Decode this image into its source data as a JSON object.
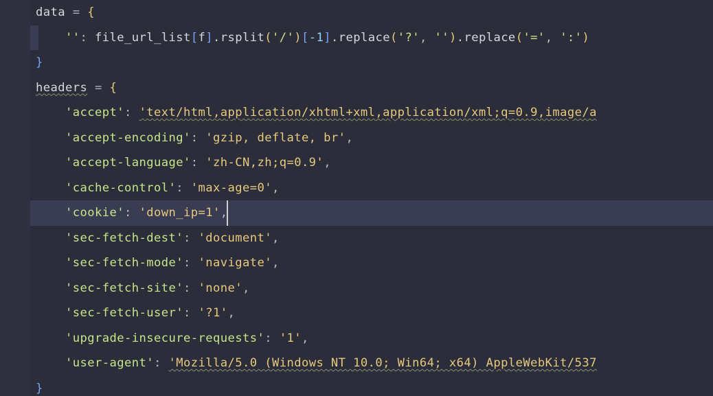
{
  "lines": [
    {
      "indent": 0,
      "segs": [
        {
          "t": "data",
          "c": "c-ident"
        },
        {
          "t": " = ",
          "c": "c-op"
        },
        {
          "t": "{",
          "c": "c-brace"
        }
      ]
    },
    {
      "indent": 1,
      "indentStripe": "big",
      "segs": [
        {
          "t": "''",
          "c": "c-str"
        },
        {
          "t": ": ",
          "c": "c-punct"
        },
        {
          "t": "file_url_list",
          "c": "c-ident"
        },
        {
          "t": "[",
          "c": "c-brace2"
        },
        {
          "t": "f",
          "c": "c-ident"
        },
        {
          "t": "]",
          "c": "c-brace2"
        },
        {
          "t": ".rsplit",
          "c": "c-ident"
        },
        {
          "t": "(",
          "c": "c-brace"
        },
        {
          "t": "'/'",
          "c": "c-str"
        },
        {
          "t": ")",
          "c": "c-brace"
        },
        {
          "t": "[",
          "c": "c-brace2"
        },
        {
          "t": "-1",
          "c": "c-num"
        },
        {
          "t": "]",
          "c": "c-brace2"
        },
        {
          "t": ".replace",
          "c": "c-ident"
        },
        {
          "t": "(",
          "c": "c-brace"
        },
        {
          "t": "'?'",
          "c": "c-str"
        },
        {
          "t": ", ",
          "c": "c-punct"
        },
        {
          "t": "''",
          "c": "c-str"
        },
        {
          "t": ")",
          "c": "c-brace"
        },
        {
          "t": ".replace",
          "c": "c-ident"
        },
        {
          "t": "(",
          "c": "c-brace"
        },
        {
          "t": "'='",
          "c": "c-str"
        },
        {
          "t": ", ",
          "c": "c-punct"
        },
        {
          "t": "':'",
          "c": "c-str"
        },
        {
          "t": ")",
          "c": "c-brace"
        }
      ]
    },
    {
      "indent": 0,
      "segs": [
        {
          "t": "}",
          "c": "c-brace2"
        }
      ]
    },
    {
      "indent": 0,
      "segs": [
        {
          "t": "headers",
          "c": "c-squig-w"
        },
        {
          "t": " = ",
          "c": "c-op"
        },
        {
          "t": "{",
          "c": "c-brace"
        }
      ]
    },
    {
      "indent": 1,
      "segs": [
        {
          "t": "'accept'",
          "c": "c-str"
        },
        {
          "t": ": ",
          "c": "c-punct"
        },
        {
          "t": "'text/html,application/xhtml+xml,application/xml;q=0.9,image/a",
          "c": "c-squig-y"
        }
      ]
    },
    {
      "indent": 1,
      "segs": [
        {
          "t": "'accept-encoding'",
          "c": "c-str"
        },
        {
          "t": ": ",
          "c": "c-punct"
        },
        {
          "t": "'gzip, deflate, br'",
          "c": "c-str-y"
        },
        {
          "t": ",",
          "c": "c-punct"
        }
      ]
    },
    {
      "indent": 1,
      "segs": [
        {
          "t": "'accept-language'",
          "c": "c-str"
        },
        {
          "t": ": ",
          "c": "c-punct"
        },
        {
          "t": "'zh-CN,zh;q=0.9'",
          "c": "c-str-y"
        },
        {
          "t": ",",
          "c": "c-punct"
        }
      ]
    },
    {
      "indent": 1,
      "segs": [
        {
          "t": "'cache-control'",
          "c": "c-str"
        },
        {
          "t": ": ",
          "c": "c-punct"
        },
        {
          "t": "'max-age=0'",
          "c": "c-str-y"
        },
        {
          "t": ",",
          "c": "c-punct"
        }
      ]
    },
    {
      "indent": 1,
      "highlight": true,
      "caret": true,
      "segs": [
        {
          "t": "'cookie'",
          "c": "c-str"
        },
        {
          "t": ": ",
          "c": "c-punct"
        },
        {
          "t": "'down_ip=1'",
          "c": "c-str-y"
        },
        {
          "t": ",",
          "c": "c-punct"
        }
      ]
    },
    {
      "indent": 1,
      "segs": [
        {
          "t": "'sec-fetch-dest'",
          "c": "c-str"
        },
        {
          "t": ": ",
          "c": "c-punct"
        },
        {
          "t": "'document'",
          "c": "c-str-y"
        },
        {
          "t": ",",
          "c": "c-punct"
        }
      ]
    },
    {
      "indent": 1,
      "segs": [
        {
          "t": "'sec-fetch-mode'",
          "c": "c-str"
        },
        {
          "t": ": ",
          "c": "c-punct"
        },
        {
          "t": "'navigate'",
          "c": "c-str-y"
        },
        {
          "t": ",",
          "c": "c-punct"
        }
      ]
    },
    {
      "indent": 1,
      "segs": [
        {
          "t": "'sec-fetch-site'",
          "c": "c-str"
        },
        {
          "t": ": ",
          "c": "c-punct"
        },
        {
          "t": "'none'",
          "c": "c-str-y"
        },
        {
          "t": ",",
          "c": "c-punct"
        }
      ]
    },
    {
      "indent": 1,
      "segs": [
        {
          "t": "'sec-fetch-user'",
          "c": "c-str"
        },
        {
          "t": ": ",
          "c": "c-punct"
        },
        {
          "t": "'?1'",
          "c": "c-str-y"
        },
        {
          "t": ",",
          "c": "c-punct"
        }
      ]
    },
    {
      "indent": 1,
      "segs": [
        {
          "t": "'upgrade-insecure-requests'",
          "c": "c-str"
        },
        {
          "t": ": ",
          "c": "c-punct"
        },
        {
          "t": "'1'",
          "c": "c-str-y"
        },
        {
          "t": ",",
          "c": "c-punct"
        }
      ]
    },
    {
      "indent": 1,
      "segs": [
        {
          "t": "'user-agent'",
          "c": "c-str"
        },
        {
          "t": ": ",
          "c": "c-punct"
        },
        {
          "t": "'Mozilla/5.0 (Windows NT 10.0; Win64; x64) AppleWebKit/537",
          "c": "c-squig-y"
        }
      ]
    },
    {
      "indent": 0,
      "segs": [
        {
          "t": "}",
          "c": "c-brace2"
        }
      ]
    }
  ],
  "indentUnit": "    "
}
